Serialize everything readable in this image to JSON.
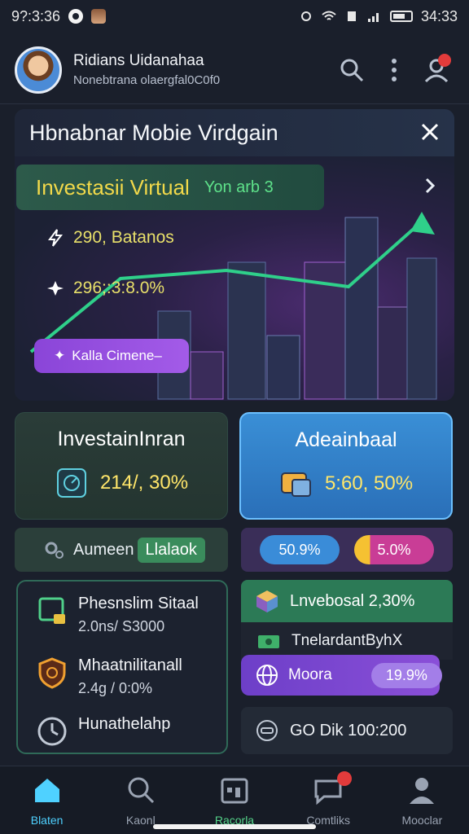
{
  "status_bar": {
    "time_left": "9?:3:36",
    "time_right": "34:33"
  },
  "header": {
    "name": "Ridians Uidanahaa",
    "subtitle": "Nonebtrana olaergfal0C0f0"
  },
  "banner": {
    "title": "Hbnabnar Mobie Virdgain",
    "chip_label": "Investasii Virtual",
    "chip_tag": "Yon arb 3",
    "stat_1": "290, Batanos",
    "stat_2": "296;:3:8.0%",
    "cta_label": "Kalla Cimene–"
  },
  "cards": {
    "invest": {
      "title": "InvestainInran",
      "value": "214/, 30%"
    },
    "adean": {
      "title": "Adeainbaal",
      "value": "5:60, 50%"
    }
  },
  "pills": {
    "green_label": "Aumeen",
    "green_highlight": "Llalaok",
    "purple_left": "50.9%",
    "purple_right": "5.0%"
  },
  "left_list": [
    {
      "title": "Phesnslim Sitaal",
      "sub": "2.0ns/ S3000"
    },
    {
      "title": "Mhaatnilitanall",
      "sub": "2.4g / 0:0%"
    },
    {
      "title": "Hunathelahp",
      "sub": ""
    }
  ],
  "right_list": {
    "row1": "Lnvebosal 2,30%",
    "row2": "TnelardantByhX",
    "row3_label": "Moora",
    "row3_pct": "19.9%",
    "row4": "GO Dik 100:200"
  },
  "nav": [
    {
      "label": "Blaten"
    },
    {
      "label": "Kaonl"
    },
    {
      "label": "Racorla"
    },
    {
      "label": "Comtliks"
    },
    {
      "label": "Mooclar"
    }
  ],
  "colors": {
    "background": "#1a1f2b",
    "accent_yellow": "#ffe66a",
    "accent_green": "#3a8c5c",
    "accent_purple": "#8a45d8",
    "accent_blue": "#3a8fd6",
    "nav_active": "#4fd1ff"
  }
}
